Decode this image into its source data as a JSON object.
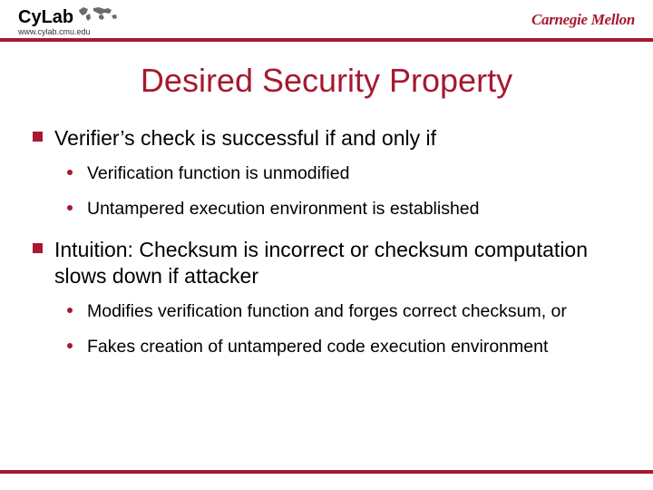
{
  "header": {
    "cylab_text": "CyLab",
    "cylab_url": "www.cylab.cmu.edu",
    "cmu_text": "Carnegie Mellon"
  },
  "title": "Desired Security Property",
  "bullets": {
    "b1": "Verifier’s check is successful if and only if",
    "b1_1": "Verification function is unmodified",
    "b1_2": "Untampered execution environment is established",
    "b2": "Intuition: Checksum is incorrect or checksum computation slows down if attacker",
    "b2_1": "Modifies verification function and forges correct checksum, or",
    "b2_2": "Fakes creation of untampered code execution environment"
  },
  "colors": {
    "accent": "#a61930"
  }
}
